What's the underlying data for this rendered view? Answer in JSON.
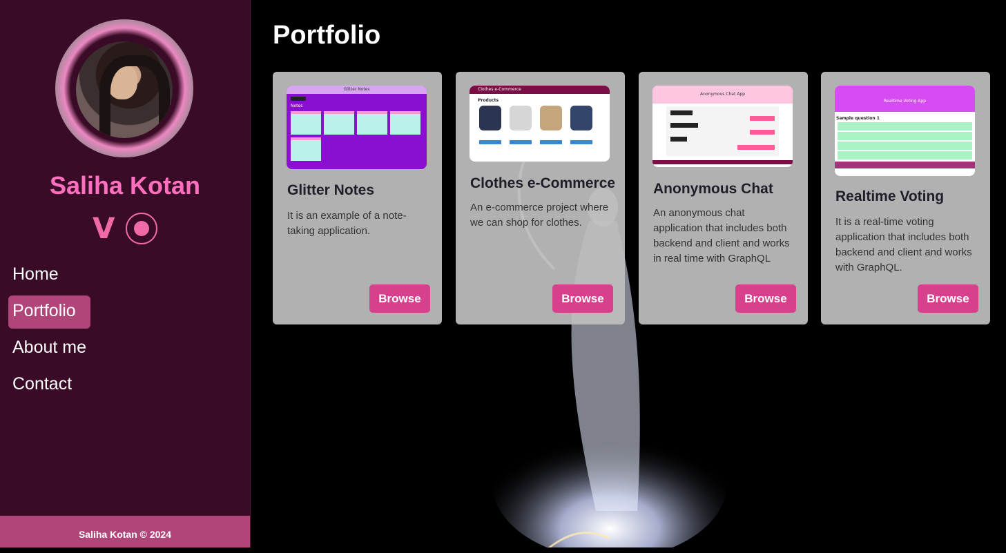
{
  "sidebar": {
    "name": "Saliha Kotan",
    "nav": [
      {
        "label": "Home",
        "active": false
      },
      {
        "label": "Portfolio",
        "active": true
      },
      {
        "label": "About me",
        "active": false
      },
      {
        "label": "Contact",
        "active": false
      }
    ],
    "footer": "Saliha Kotan © 2024",
    "badges": [
      "vegan-icon",
      "cruelty-free-icon"
    ]
  },
  "main": {
    "title": "Portfolio",
    "cards": [
      {
        "title": "Glitter Notes",
        "description": "It is an example of a note-taking application.",
        "button": "Browse",
        "thumb": {
          "header": "Glitter Notes",
          "section": "Notes"
        }
      },
      {
        "title": "Clothes e-Commerce",
        "description": "An e-commerce project where we can shop for clothes.",
        "button": "Browse",
        "thumb": {
          "header": "Clothes e-Commerce",
          "section": "Products"
        }
      },
      {
        "title": "Anonymous Chat",
        "description": "An anonymous chat application that includes both backend and client and works in real time with GraphQL",
        "button": "Browse",
        "thumb": {
          "header": "Anonymous Chat App"
        }
      },
      {
        "title": "Realtime Voting",
        "description": "It is a real-time voting application that includes both backend and client and works with GraphQL.",
        "button": "Browse",
        "thumb": {
          "header": "Realtime Voting App",
          "section": "Sample question 1"
        }
      }
    ]
  },
  "colors": {
    "sidebar_bg": "#3a0b26",
    "accent": "#d6408d",
    "name_pink": "#ff6fbf",
    "footer_bg": "#b0457a"
  }
}
